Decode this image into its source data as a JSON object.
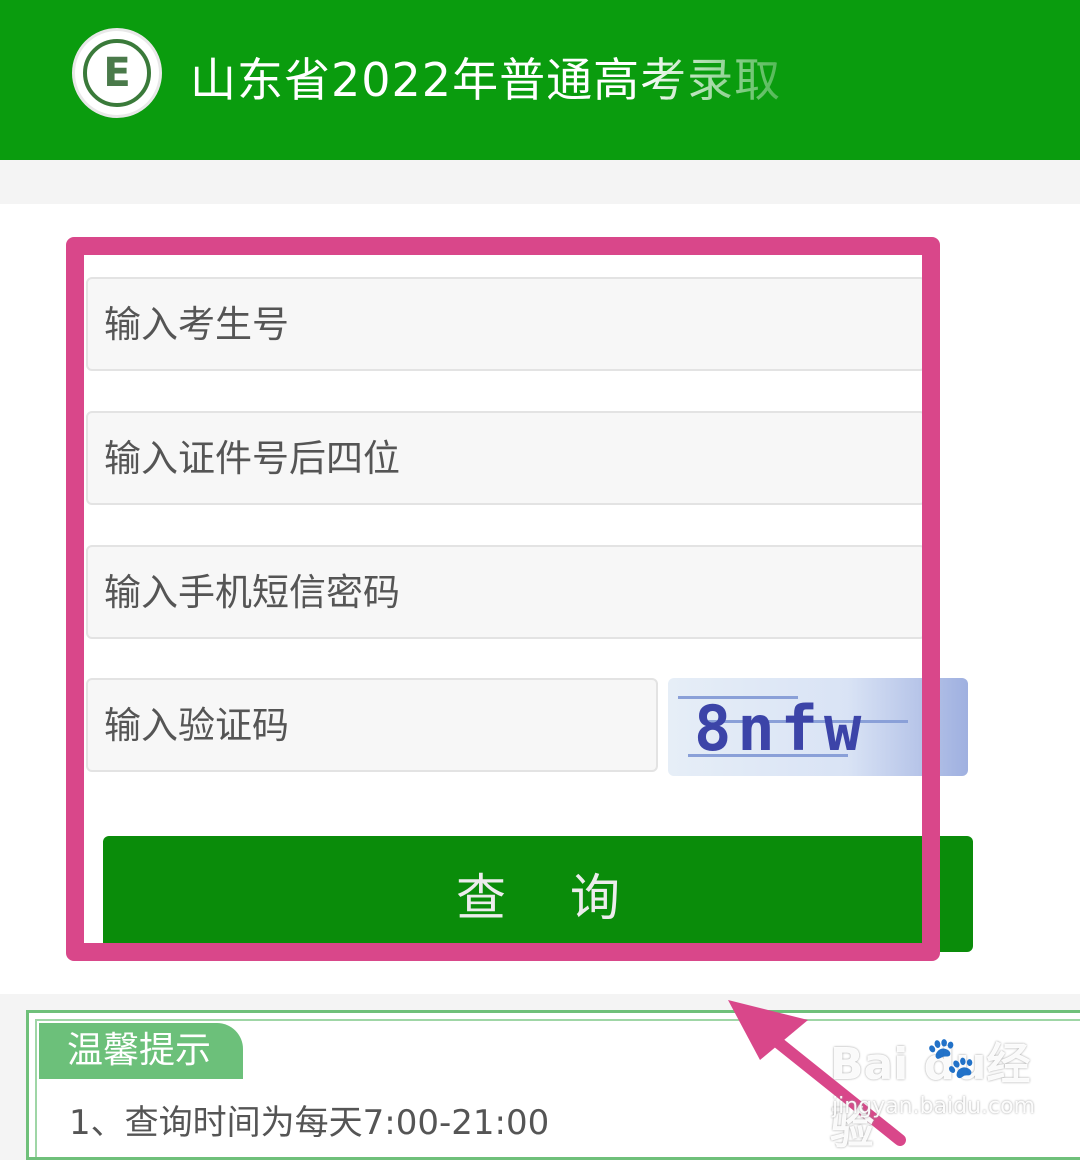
{
  "header": {
    "logo_letter": "E",
    "title": "山东省2022年普通高考录取"
  },
  "form": {
    "exam_number": {
      "placeholder": "输入考生号",
      "value": ""
    },
    "id_last_four": {
      "placeholder": "输入证件号后四位",
      "value": ""
    },
    "sms_password": {
      "placeholder": "输入手机短信密码",
      "value": ""
    },
    "captcha": {
      "placeholder": "输入验证码",
      "value": "",
      "image_text": "8nfw"
    },
    "query_label": "查 询"
  },
  "tips": {
    "title": "温馨提示",
    "lines": [
      "1、查询时间为每天7:00-21:00"
    ]
  },
  "watermark": {
    "brand": "Bai  du经验",
    "url": "jingyan.baidu.com"
  },
  "colors": {
    "header_green": "#0a9c0e",
    "button_green": "#0a8c0a",
    "highlight_pink": "#d9478a",
    "tips_green": "#6cc07a"
  }
}
